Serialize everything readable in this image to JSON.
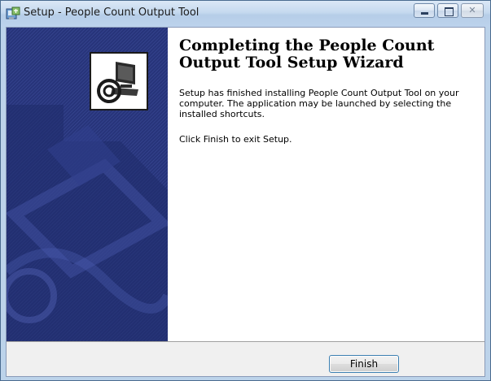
{
  "window": {
    "title": "Setup - People Count Output Tool",
    "icons": {
      "app": "setup-installer-icon",
      "minimize": "minimize-icon",
      "maximize": "maximize-icon",
      "close": "close-icon"
    }
  },
  "wizard": {
    "image_icon": "installer-computer-icon",
    "heading": "Completing the People Count Output Tool Setup Wizard",
    "paragraph1": "Setup has finished installing People Count Output Tool on your computer. The application may be launched by selecting the installed shortcuts.",
    "paragraph2": "Click Finish to exit Setup."
  },
  "buttons": {
    "finish_label": "Finish"
  },
  "colors": {
    "banner_blue": "#27347a",
    "titlebar": "#c5d9ef",
    "button_border": "#3c7fb1"
  }
}
